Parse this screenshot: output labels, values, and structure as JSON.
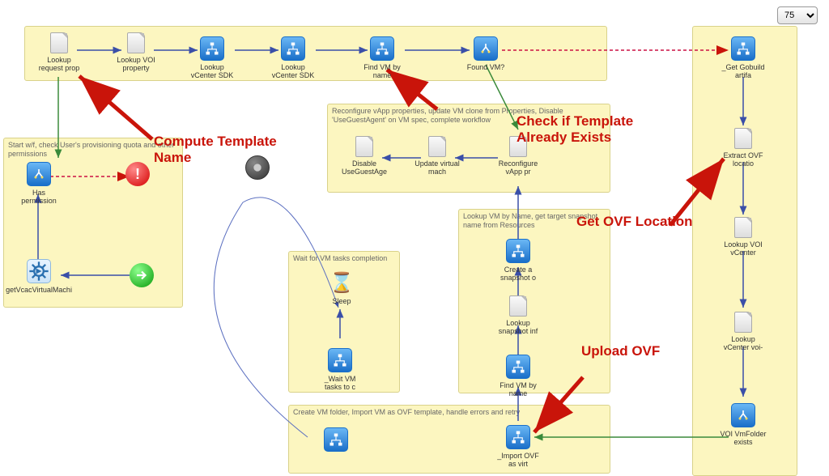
{
  "zoom": {
    "value": "75"
  },
  "boxes": {
    "topRow": {
      "title": ""
    },
    "permissions": {
      "title": "Start w/f, check User's provisioning quota and other permissions"
    },
    "reconfigure": {
      "title": "Reconfigure vApp properties, update VM clone from Properties, Disable 'UseGuestAgent' on VM spec, complete workflow"
    },
    "snapshot": {
      "title": "Lookup VM by Name, get target snapshot name from Resources"
    },
    "waitTasks": {
      "title": "Wait for VM tasks completion"
    },
    "createFolder": {
      "title": "Create VM folder, Import VM as OVF template, handle errors and retry"
    },
    "rightCol": {
      "title": ""
    }
  },
  "nodes": {
    "lookupRequestProp": "Lookup request prop",
    "lookupVOIProperty": "Lookup VOI property",
    "lookupVCenterSDK1": "Lookup vCenter SDK",
    "lookupVCenterSDK2": "Lookup vCenter SDK",
    "findVMByNameTop": "Find VM by name",
    "foundVM": "Found VM?",
    "getGobuildArtifa": "_Get Gobuild artifa",
    "hasPermission": "Has permission",
    "getVcacVirtualMachi": "getVcacVirtualMachi",
    "disableUseGuestAge": "Disable UseGuestAge",
    "updateVirtualMach": "Update virtual mach",
    "reconfigureVAppPr": "Reconfigure vApp pr",
    "createSnapshot": "Create a snapshot o",
    "lookupSnapshotInf": "Lookup snapshot inf",
    "findVMByNameInner": "Find VM by name",
    "sleep": "Sleep",
    "waitVMTasks": "_Wait VM tasks to c",
    "importOVF": "_Import OVF as virt",
    "extractOVFLocatio": "Extract OVF locatio",
    "lookupVOIvCenter": "Lookup VOI vCenter",
    "lookupVCenterVoi": "Lookup vCenter voi-",
    "voiVmFolderExists": "VOI VmFolder exists"
  },
  "annotations": {
    "computeTemplate": "Compute Template Name",
    "checkTemplate": "Check if Template Already Exists",
    "getOVF": "Get OVF Location",
    "uploadOVF": "Upload OVF"
  }
}
